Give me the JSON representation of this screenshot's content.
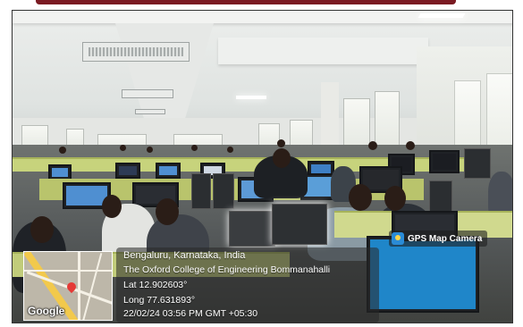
{
  "overlay": {
    "badge_label": "GPS Map Camera",
    "badge_icon": "camera-icon",
    "location": "Bengaluru, Karnataka, India",
    "place": "The Oxford College of Engineering Bommanahalli",
    "latitude": "Lat 12.902603°",
    "longitude": "Long 77.631893°",
    "timestamp": "22/02/24 03:56 PM GMT +05:30",
    "map_logo": "Google",
    "pin_icon": "map-pin-icon"
  },
  "colors": {
    "desk": "#c7d37c",
    "screen": "#4f8fd1",
    "top_band": "#7a1a22"
  }
}
